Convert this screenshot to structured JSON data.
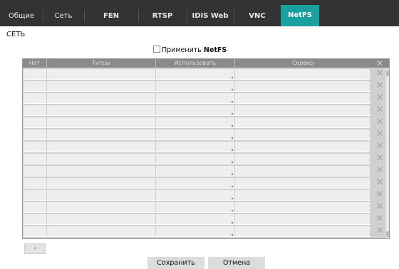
{
  "tabs": [
    {
      "label": "Общие",
      "active": false
    },
    {
      "label": "Сеть",
      "active": false
    },
    {
      "label": "FEN",
      "active": false
    },
    {
      "label": "RTSP",
      "active": false
    },
    {
      "label": "IDIS Web",
      "active": false
    },
    {
      "label": "VNC",
      "active": false
    },
    {
      "label": "NetFS",
      "active": true
    }
  ],
  "section_title": "СЕТЬ",
  "apply": {
    "label_prefix": "Применить",
    "label_bold": "NetFS",
    "checked": false
  },
  "table": {
    "columns": [
      "Нет",
      "Титры",
      "Использовать",
      "Сервер"
    ],
    "delete_icon": "close-icon",
    "row_count": 14
  },
  "add_button": {
    "label": "+"
  },
  "buttons": {
    "save": "Сохранить",
    "cancel": "Отмена"
  },
  "colors": {
    "tabbar": "#333333",
    "active_tab": "#1aa0a0"
  }
}
